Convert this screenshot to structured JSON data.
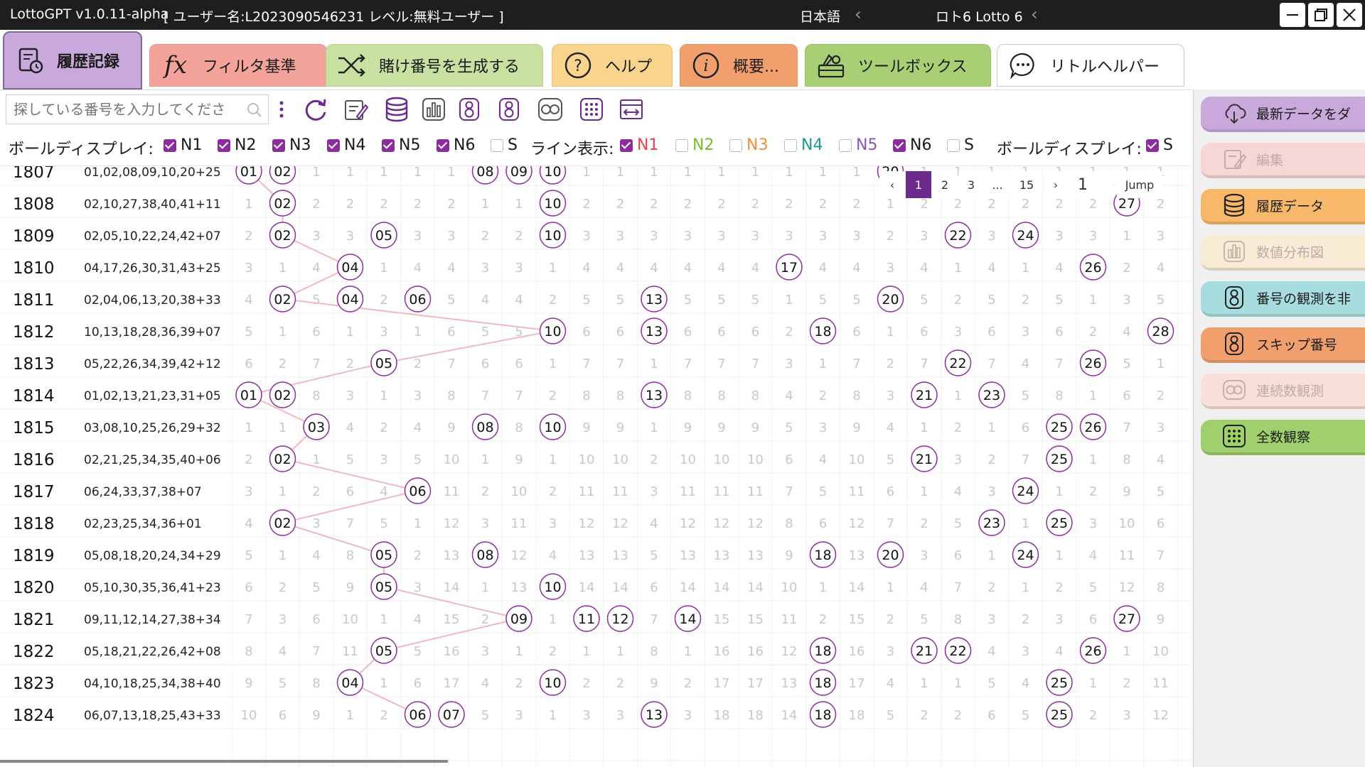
{
  "window": {
    "title": "LottoGPT v1.0.11-alpha",
    "user_info": "[ ユーザー名:L2023090546231  レベル:無料ユーザー ]",
    "language": "日本語",
    "game": "ロト6 Lotto 6"
  },
  "tabs": [
    {
      "label": "履歴記録",
      "icon": "history-record-icon",
      "color": "#c9a9dc"
    },
    {
      "label": "フィルタ基準",
      "icon": "fx-icon",
      "color": "#f3a39a"
    },
    {
      "label": "賭け番号を生成する",
      "icon": "shuffle-icon",
      "color": "#c8e0a0"
    },
    {
      "label": "ヘルプ",
      "icon": "help-icon",
      "color": "#f8d48c"
    },
    {
      "label": "概要...",
      "icon": "info-icon",
      "color": "#f1a06d"
    },
    {
      "label": "ツールボックス",
      "icon": "toolbox-icon",
      "color": "#a9cf74"
    },
    {
      "label": "リトルヘルパー",
      "icon": "chat-bubble-icon",
      "color": "#ffffff"
    }
  ],
  "search": {
    "placeholder": "探している番号を入力してくださ"
  },
  "filters": {
    "ball_display_label": "ボールディスプレイ:",
    "ball_display": [
      {
        "label": "N1",
        "checked": true
      },
      {
        "label": "N2",
        "checked": true
      },
      {
        "label": "N3",
        "checked": true
      },
      {
        "label": "N4",
        "checked": true
      },
      {
        "label": "N5",
        "checked": true
      },
      {
        "label": "N6",
        "checked": true
      },
      {
        "label": "S",
        "checked": false
      }
    ],
    "line_display_label": "ライン表示:",
    "line_display": [
      {
        "label": "N1",
        "checked": true,
        "color": "#e0434e"
      },
      {
        "label": "N2",
        "checked": false,
        "color": "#7dba2c"
      },
      {
        "label": "N3",
        "checked": false,
        "color": "#f0913a"
      },
      {
        "label": "N4",
        "checked": false,
        "color": "#1b9b8e"
      },
      {
        "label": "N5",
        "checked": false,
        "color": "#8a55b8"
      },
      {
        "label": "N6",
        "checked": true,
        "color": "#1a1a1a"
      },
      {
        "label": "S",
        "checked": false,
        "color": "#1a1a1a"
      }
    ],
    "ball_display2_label": "ボールディスプレイ:",
    "ball_display2": [
      {
        "label": "S",
        "checked": true
      }
    ]
  },
  "pagination": {
    "pages": [
      "1",
      "2",
      "3",
      "...",
      "15"
    ],
    "current": "1",
    "input": "1",
    "jump": "Jump"
  },
  "draws": [
    {
      "id": "1807",
      "numbers": "01,02,08,09,10,20+25"
    },
    {
      "id": "1808",
      "numbers": "02,10,27,38,40,41+11"
    },
    {
      "id": "1809",
      "numbers": "02,05,10,22,24,42+07"
    },
    {
      "id": "1810",
      "numbers": "04,17,26,30,31,43+25"
    },
    {
      "id": "1811",
      "numbers": "02,04,06,13,20,38+33"
    },
    {
      "id": "1812",
      "numbers": "10,13,18,28,36,39+07"
    },
    {
      "id": "1813",
      "numbers": "05,22,26,34,39,42+12"
    },
    {
      "id": "1814",
      "numbers": "01,02,13,21,23,31+05"
    },
    {
      "id": "1815",
      "numbers": "03,08,10,25,26,29+32"
    },
    {
      "id": "1816",
      "numbers": "02,21,25,34,35,40+06"
    },
    {
      "id": "1817",
      "numbers": "06,24,33,37,38+07"
    },
    {
      "id": "1818",
      "numbers": "02,23,25,34,36+01"
    },
    {
      "id": "1819",
      "numbers": "05,08,18,20,24,34+29"
    },
    {
      "id": "1820",
      "numbers": "05,10,30,35,36,41+23"
    },
    {
      "id": "1821",
      "numbers": "09,11,12,14,27,38+34"
    },
    {
      "id": "1822",
      "numbers": "05,18,21,22,26,42+08"
    },
    {
      "id": "1823",
      "numbers": "04,10,18,25,34,38+40"
    },
    {
      "id": "1824",
      "numbers": "06,07,13,18,25,43+33"
    }
  ],
  "right_panel": [
    {
      "label": "最新データをダ",
      "icon": "cloud-download-icon",
      "color": "#c9a9dc",
      "enabled": true
    },
    {
      "label": "編集",
      "icon": "edit-icon",
      "color": "#f7d6d6",
      "enabled": false
    },
    {
      "label": "履歴データ",
      "icon": "database-icon",
      "color": "#f8b86a",
      "enabled": true
    },
    {
      "label": "数値分布図",
      "icon": "bar-chart-icon",
      "color": "#f8ecd4",
      "enabled": false
    },
    {
      "label": "番号の観測を非",
      "icon": "number-eight-icon",
      "color": "#a8dde0",
      "enabled": true
    },
    {
      "label": "スキップ番号",
      "icon": "skip-number-icon",
      "color": "#f1a06d",
      "enabled": true
    },
    {
      "label": "連続数観測",
      "icon": "infinity-icon",
      "color": "#f7e0d8",
      "enabled": false
    },
    {
      "label": "全数観察",
      "icon": "dot-grid-icon",
      "color": "#9fd06b",
      "enabled": true
    }
  ],
  "colors": {
    "accent": "#8b2d9c",
    "ball_red": "#d63b35",
    "ball_green": "#6aa81c",
    "ball_teal": "#0e8a8c",
    "column_fill": "#e3f0e3",
    "link_line": "#f2b8c0"
  }
}
